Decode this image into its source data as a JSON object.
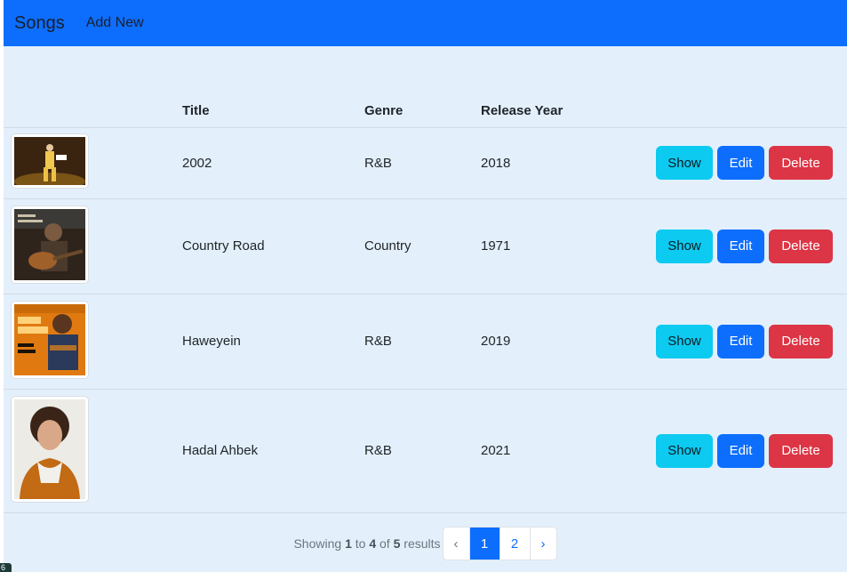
{
  "navbar": {
    "brand": "Songs",
    "add_new": "Add New"
  },
  "table": {
    "headers": {
      "image": "",
      "title": "Title",
      "genre": "Genre",
      "year": "Release Year"
    },
    "rows": [
      {
        "title": "2002",
        "genre": "R&B",
        "year": "2018",
        "image": "performer-on-stage-thumbnail"
      },
      {
        "title": "Country Road",
        "genre": "Country",
        "year": "1971",
        "image": "guitar-player-album-thumbnail"
      },
      {
        "title": "Haweyein",
        "genre": "R&B",
        "year": "2019",
        "image": "top-artist-cover-thumbnail",
        "image_text": "TOP ARTIST ARIJIT SINGH"
      },
      {
        "title": "Hadal Ahbek",
        "genre": "R&B",
        "year": "2021",
        "image": "curly-haired-portrait-thumbnail"
      }
    ],
    "actions": {
      "show": "Show",
      "edit": "Edit",
      "delete": "Delete"
    }
  },
  "pagination": {
    "showing": "Showing",
    "from": "1",
    "to_word": "to",
    "to": "4",
    "of_word": "of",
    "total": "5",
    "results": "results",
    "prev": "‹",
    "pages": [
      "1",
      "2"
    ],
    "current_page": "1",
    "next": "›"
  },
  "corner_badge": "6",
  "colors": {
    "navbar": "#0d6efd",
    "content_bg": "#e3f0fc",
    "show_button": "#0dcaf0",
    "edit_button": "#0d6efd",
    "delete_button": "#dc3545"
  }
}
